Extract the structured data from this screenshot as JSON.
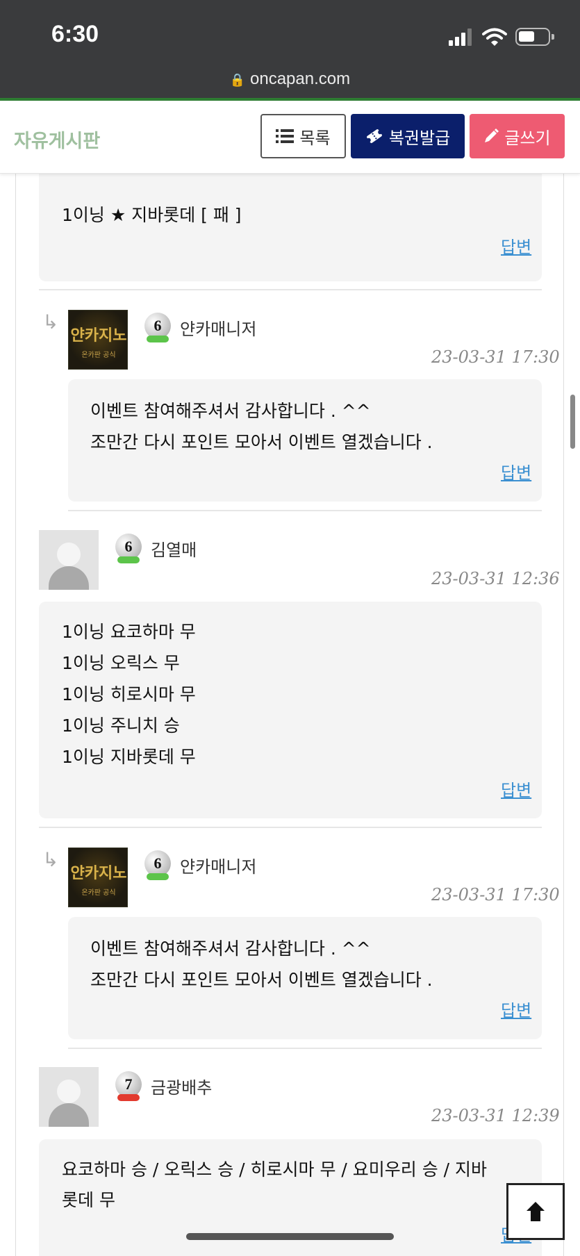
{
  "status": {
    "time": "6:30",
    "url": "oncapan.com"
  },
  "header": {
    "title": "자유게시판",
    "btn_list": "목록",
    "btn_ticket": "복권발급",
    "btn_write": "글쓰기"
  },
  "comments": [
    {
      "lines": [
        "1이닝 ★ 지바롯데    [ 패 ]"
      ],
      "reply_label": "답변"
    },
    {
      "is_reply": true,
      "user": "얀카매니저",
      "level": "6",
      "date": "23-03-31 17:30",
      "lines": [
        "이벤트 참여해주셔서 감사합니다 . ^^",
        "조만간 다시 포인트 모아서 이벤트 열겠습니다 ."
      ],
      "reply_label": "답변"
    },
    {
      "user": "김열매",
      "level": "6",
      "date": "23-03-31 12:36",
      "lines": [
        "1이닝 요코하마 무",
        "1이닝 오릭스  무",
        "1이닝 히로시마 무",
        "1이닝 주니치 승",
        "1이닝 지바롯데 무"
      ],
      "reply_label": "답변"
    },
    {
      "is_reply": true,
      "user": "얀카매니저",
      "level": "6",
      "date": "23-03-31 17:30",
      "lines": [
        "이벤트 참여해주셔서 감사합니다 . ^^",
        "조만간 다시 포인트 모아서 이벤트 열겠습니다 ."
      ],
      "reply_label": "답변"
    },
    {
      "user": "금광배추",
      "level": "7",
      "date": "23-03-31 12:39",
      "lines": [
        "요코하마  승 / 오릭스  승 / 히로시마  무 / 요미우리  승 / 지바",
        "롯데  무"
      ],
      "reply_label": "답변"
    }
  ],
  "icons": {
    "list": "list-icon",
    "ticket": "ticket-icon",
    "pencil": "pencil-icon",
    "reply_arrow": "reply-arrow-icon",
    "scroll_top": "arrow-up-icon"
  },
  "colors": {
    "title_green": "#9fc09f",
    "ticket_navy": "#0b1f6b",
    "write_pink": "#ee5b72",
    "link_blue": "#3a8fd1",
    "status_bar": "#3a3b3d"
  }
}
